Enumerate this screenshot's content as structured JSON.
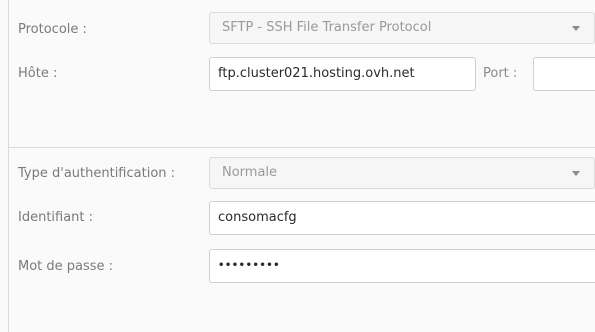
{
  "form": {
    "protocol": {
      "label": "Protocole :",
      "value": "SFTP - SSH File Transfer Protocol"
    },
    "host": {
      "label": "Hôte :",
      "value": "ftp.cluster021.hosting.ovh.net"
    },
    "port": {
      "label": "Port :",
      "value": ""
    },
    "auth_type": {
      "label": "Type d'authentification :",
      "value": "Normale"
    },
    "username": {
      "label": "Identifiant :",
      "value": "consomacfg"
    },
    "password": {
      "label": "Mot de passe :",
      "value": "•••••••••"
    }
  },
  "icons": {
    "dropdown": "chevron-down-icon"
  }
}
